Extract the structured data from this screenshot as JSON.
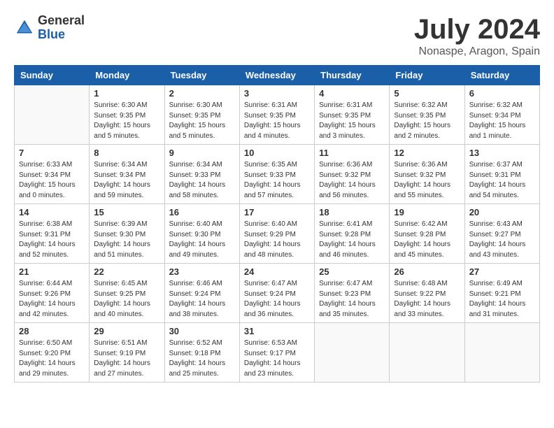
{
  "header": {
    "logo_general": "General",
    "logo_blue": "Blue",
    "month_title": "July 2024",
    "location": "Nonaspe, Aragon, Spain"
  },
  "days_of_week": [
    "Sunday",
    "Monday",
    "Tuesday",
    "Wednesday",
    "Thursday",
    "Friday",
    "Saturday"
  ],
  "weeks": [
    [
      {
        "day": "",
        "info": ""
      },
      {
        "day": "1",
        "info": "Sunrise: 6:30 AM\nSunset: 9:35 PM\nDaylight: 15 hours\nand 5 minutes."
      },
      {
        "day": "2",
        "info": "Sunrise: 6:30 AM\nSunset: 9:35 PM\nDaylight: 15 hours\nand 5 minutes."
      },
      {
        "day": "3",
        "info": "Sunrise: 6:31 AM\nSunset: 9:35 PM\nDaylight: 15 hours\nand 4 minutes."
      },
      {
        "day": "4",
        "info": "Sunrise: 6:31 AM\nSunset: 9:35 PM\nDaylight: 15 hours\nand 3 minutes."
      },
      {
        "day": "5",
        "info": "Sunrise: 6:32 AM\nSunset: 9:35 PM\nDaylight: 15 hours\nand 2 minutes."
      },
      {
        "day": "6",
        "info": "Sunrise: 6:32 AM\nSunset: 9:34 PM\nDaylight: 15 hours\nand 1 minute."
      }
    ],
    [
      {
        "day": "7",
        "info": "Sunrise: 6:33 AM\nSunset: 9:34 PM\nDaylight: 15 hours\nand 0 minutes."
      },
      {
        "day": "8",
        "info": "Sunrise: 6:34 AM\nSunset: 9:34 PM\nDaylight: 14 hours\nand 59 minutes."
      },
      {
        "day": "9",
        "info": "Sunrise: 6:34 AM\nSunset: 9:33 PM\nDaylight: 14 hours\nand 58 minutes."
      },
      {
        "day": "10",
        "info": "Sunrise: 6:35 AM\nSunset: 9:33 PM\nDaylight: 14 hours\nand 57 minutes."
      },
      {
        "day": "11",
        "info": "Sunrise: 6:36 AM\nSunset: 9:32 PM\nDaylight: 14 hours\nand 56 minutes."
      },
      {
        "day": "12",
        "info": "Sunrise: 6:36 AM\nSunset: 9:32 PM\nDaylight: 14 hours\nand 55 minutes."
      },
      {
        "day": "13",
        "info": "Sunrise: 6:37 AM\nSunset: 9:31 PM\nDaylight: 14 hours\nand 54 minutes."
      }
    ],
    [
      {
        "day": "14",
        "info": "Sunrise: 6:38 AM\nSunset: 9:31 PM\nDaylight: 14 hours\nand 52 minutes."
      },
      {
        "day": "15",
        "info": "Sunrise: 6:39 AM\nSunset: 9:30 PM\nDaylight: 14 hours\nand 51 minutes."
      },
      {
        "day": "16",
        "info": "Sunrise: 6:40 AM\nSunset: 9:30 PM\nDaylight: 14 hours\nand 49 minutes."
      },
      {
        "day": "17",
        "info": "Sunrise: 6:40 AM\nSunset: 9:29 PM\nDaylight: 14 hours\nand 48 minutes."
      },
      {
        "day": "18",
        "info": "Sunrise: 6:41 AM\nSunset: 9:28 PM\nDaylight: 14 hours\nand 46 minutes."
      },
      {
        "day": "19",
        "info": "Sunrise: 6:42 AM\nSunset: 9:28 PM\nDaylight: 14 hours\nand 45 minutes."
      },
      {
        "day": "20",
        "info": "Sunrise: 6:43 AM\nSunset: 9:27 PM\nDaylight: 14 hours\nand 43 minutes."
      }
    ],
    [
      {
        "day": "21",
        "info": "Sunrise: 6:44 AM\nSunset: 9:26 PM\nDaylight: 14 hours\nand 42 minutes."
      },
      {
        "day": "22",
        "info": "Sunrise: 6:45 AM\nSunset: 9:25 PM\nDaylight: 14 hours\nand 40 minutes."
      },
      {
        "day": "23",
        "info": "Sunrise: 6:46 AM\nSunset: 9:24 PM\nDaylight: 14 hours\nand 38 minutes."
      },
      {
        "day": "24",
        "info": "Sunrise: 6:47 AM\nSunset: 9:24 PM\nDaylight: 14 hours\nand 36 minutes."
      },
      {
        "day": "25",
        "info": "Sunrise: 6:47 AM\nSunset: 9:23 PM\nDaylight: 14 hours\nand 35 minutes."
      },
      {
        "day": "26",
        "info": "Sunrise: 6:48 AM\nSunset: 9:22 PM\nDaylight: 14 hours\nand 33 minutes."
      },
      {
        "day": "27",
        "info": "Sunrise: 6:49 AM\nSunset: 9:21 PM\nDaylight: 14 hours\nand 31 minutes."
      }
    ],
    [
      {
        "day": "28",
        "info": "Sunrise: 6:50 AM\nSunset: 9:20 PM\nDaylight: 14 hours\nand 29 minutes."
      },
      {
        "day": "29",
        "info": "Sunrise: 6:51 AM\nSunset: 9:19 PM\nDaylight: 14 hours\nand 27 minutes."
      },
      {
        "day": "30",
        "info": "Sunrise: 6:52 AM\nSunset: 9:18 PM\nDaylight: 14 hours\nand 25 minutes."
      },
      {
        "day": "31",
        "info": "Sunrise: 6:53 AM\nSunset: 9:17 PM\nDaylight: 14 hours\nand 23 minutes."
      },
      {
        "day": "",
        "info": ""
      },
      {
        "day": "",
        "info": ""
      },
      {
        "day": "",
        "info": ""
      }
    ]
  ]
}
